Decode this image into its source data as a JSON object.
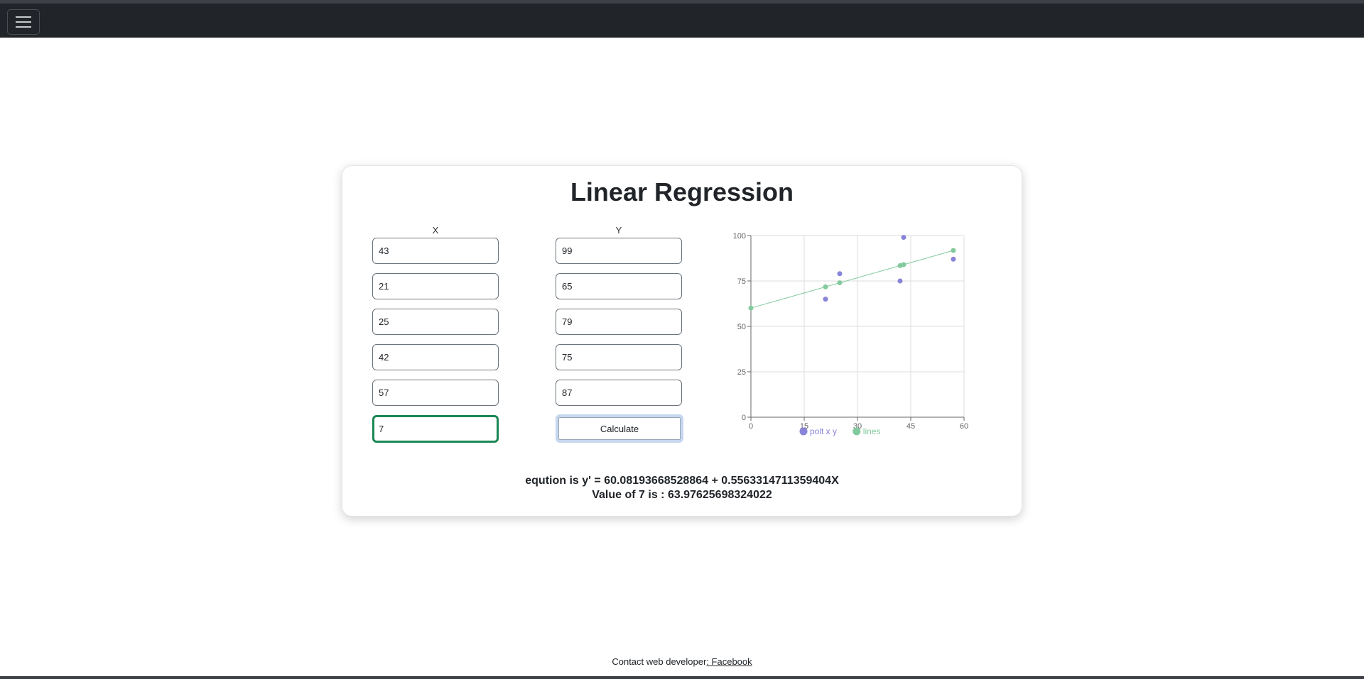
{
  "nav": {
    "toggle_icon": "hamburger-icon"
  },
  "card": {
    "title": "Linear Regression",
    "x_label": "X",
    "y_label": "Y",
    "x_values": [
      "43",
      "21",
      "25",
      "42",
      "57"
    ],
    "y_values": [
      "99",
      "65",
      "79",
      "75",
      "87"
    ],
    "predict_value": "7",
    "calculate_label": "Calculate",
    "equation": "eqution is y' = 60.08193668528864 + 0.5563314711359404X",
    "prediction": "Value of 7 is : 63.97625698324022"
  },
  "chart_data": {
    "type": "scatter",
    "xlim": [
      0,
      60
    ],
    "ylim": [
      0,
      100
    ],
    "x_ticks": [
      "0",
      "15",
      "30",
      "45",
      "60"
    ],
    "y_ticks": [
      "0",
      "25",
      "50",
      "75",
      "100"
    ],
    "grid": true,
    "legend": "bottom",
    "series": [
      {
        "name": "polt x y",
        "color": "#8884d8",
        "points": [
          [
            43,
            99
          ],
          [
            21,
            65
          ],
          [
            25,
            79
          ],
          [
            42,
            75
          ],
          [
            57,
            87
          ]
        ]
      },
      {
        "name": "lines",
        "color": "#82ca9d",
        "line": true,
        "points": [
          [
            0,
            60.08
          ],
          [
            21,
            71.76
          ],
          [
            25,
            73.99
          ],
          [
            42,
            83.45
          ],
          [
            43,
            84.0
          ],
          [
            57,
            91.79
          ]
        ]
      }
    ]
  },
  "footer": {
    "text": "Contact web developer",
    "link_label": ": Facebook"
  }
}
